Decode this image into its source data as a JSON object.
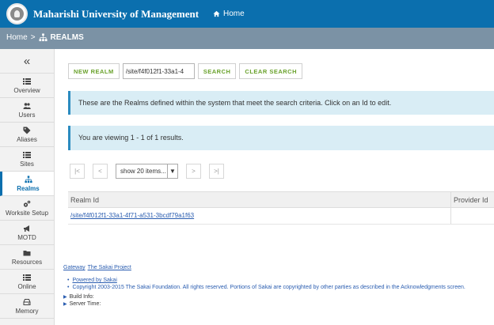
{
  "header": {
    "title": "Maharishi University of Management",
    "home_label": "Home"
  },
  "breadcrumb": {
    "home": "Home",
    "separator": ">",
    "current": "REALMS"
  },
  "sidebar": {
    "collapse_glyph": "«",
    "items": [
      {
        "label": "Overview",
        "icon": "list-icon"
      },
      {
        "label": "Users",
        "icon": "users-icon"
      },
      {
        "label": "Aliases",
        "icon": "tag-icon"
      },
      {
        "label": "Sites",
        "icon": "list-icon"
      },
      {
        "label": "Realms",
        "icon": "sitemap-icon",
        "active": true
      },
      {
        "label": "Worksite Setup",
        "icon": "gears-icon"
      },
      {
        "label": "MOTD",
        "icon": "megaphone-icon"
      },
      {
        "label": "Resources",
        "icon": "folder-icon"
      },
      {
        "label": "Online",
        "icon": "list-icon"
      },
      {
        "label": "Memory",
        "icon": "hdd-icon"
      }
    ]
  },
  "toolbar": {
    "new_realm": "NEW REALM",
    "search_value": "/site/f4f012f1-33a1-4",
    "search": "SEARCH",
    "clear_search": "CLEAR SEARCH"
  },
  "alerts": {
    "info": "These are the Realms defined within the system that meet the search criteria. Click on an Id to edit.",
    "results": "You are viewing 1 - 1 of 1 results."
  },
  "pager": {
    "first": "|<",
    "prev": "<",
    "page_size": "show 20 items...",
    "next": ">",
    "last": ">|"
  },
  "table": {
    "headers": {
      "realm_id": "Realm Id",
      "provider_id": "Provider Id"
    },
    "rows": [
      {
        "realm_id": "/site/f4f012f1-33a1-4f71-a531-3bcdf79a1f63",
        "provider_id": ""
      }
    ]
  },
  "footer": {
    "gateway": "Gateway",
    "sakai_project": "The Sakai Project",
    "powered_by": "Powered by Sakai",
    "copyright": "Copyright 2003-2015 The Sakai Foundation. All rights reserved. Portions of Sakai are copyrighted by other parties as described in the Acknowledgments screen.",
    "build_info": "Build Info:",
    "server_time": "Server Time:"
  },
  "colors": {
    "header_blue": "#0b6fae",
    "breadcrumb_gray": "#7b92a5",
    "button_green": "#6aa22c",
    "alert_bg": "#d9edf5"
  }
}
